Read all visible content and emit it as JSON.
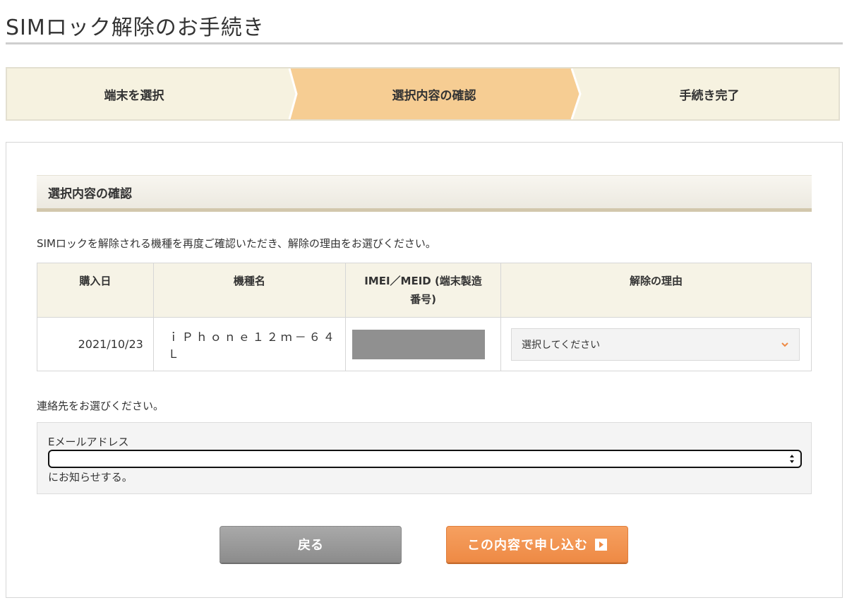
{
  "page": {
    "title": "SIMロック解除のお手続き"
  },
  "stepper": {
    "steps": [
      {
        "label": "端末を選択",
        "active": false
      },
      {
        "label": "選択内容の確認",
        "active": true
      },
      {
        "label": "手続き完了",
        "active": false
      }
    ],
    "active_color": "#f6cd93",
    "inactive_color": "#f6f2e0"
  },
  "section": {
    "header": "選択内容の確認",
    "intro": "SIMロックを解除される機種を再度ご確認いただき、解除の理由をお選びください。"
  },
  "table": {
    "headers": {
      "purchase_date": "購入日",
      "model": "機種名",
      "imei_line1": "IMEI／MEID (端末製造",
      "imei_line2": "番号)",
      "reason": "解除の理由"
    },
    "row": {
      "purchase_date": "2021/10/23",
      "model": "ｉＰｈｏｎｅ１２ｍ－６４Ｌ",
      "reason_placeholder": "選択してください"
    }
  },
  "contact": {
    "prompt": "連絡先をお選びください。",
    "label": "Eメールアドレス",
    "selected_value": "",
    "suffix": "にお知らせする。"
  },
  "buttons": {
    "back": "戻る",
    "submit": "この内容で申し込む"
  },
  "colors": {
    "accent_orange": "#ee8a45",
    "back_gray": "#999999"
  }
}
